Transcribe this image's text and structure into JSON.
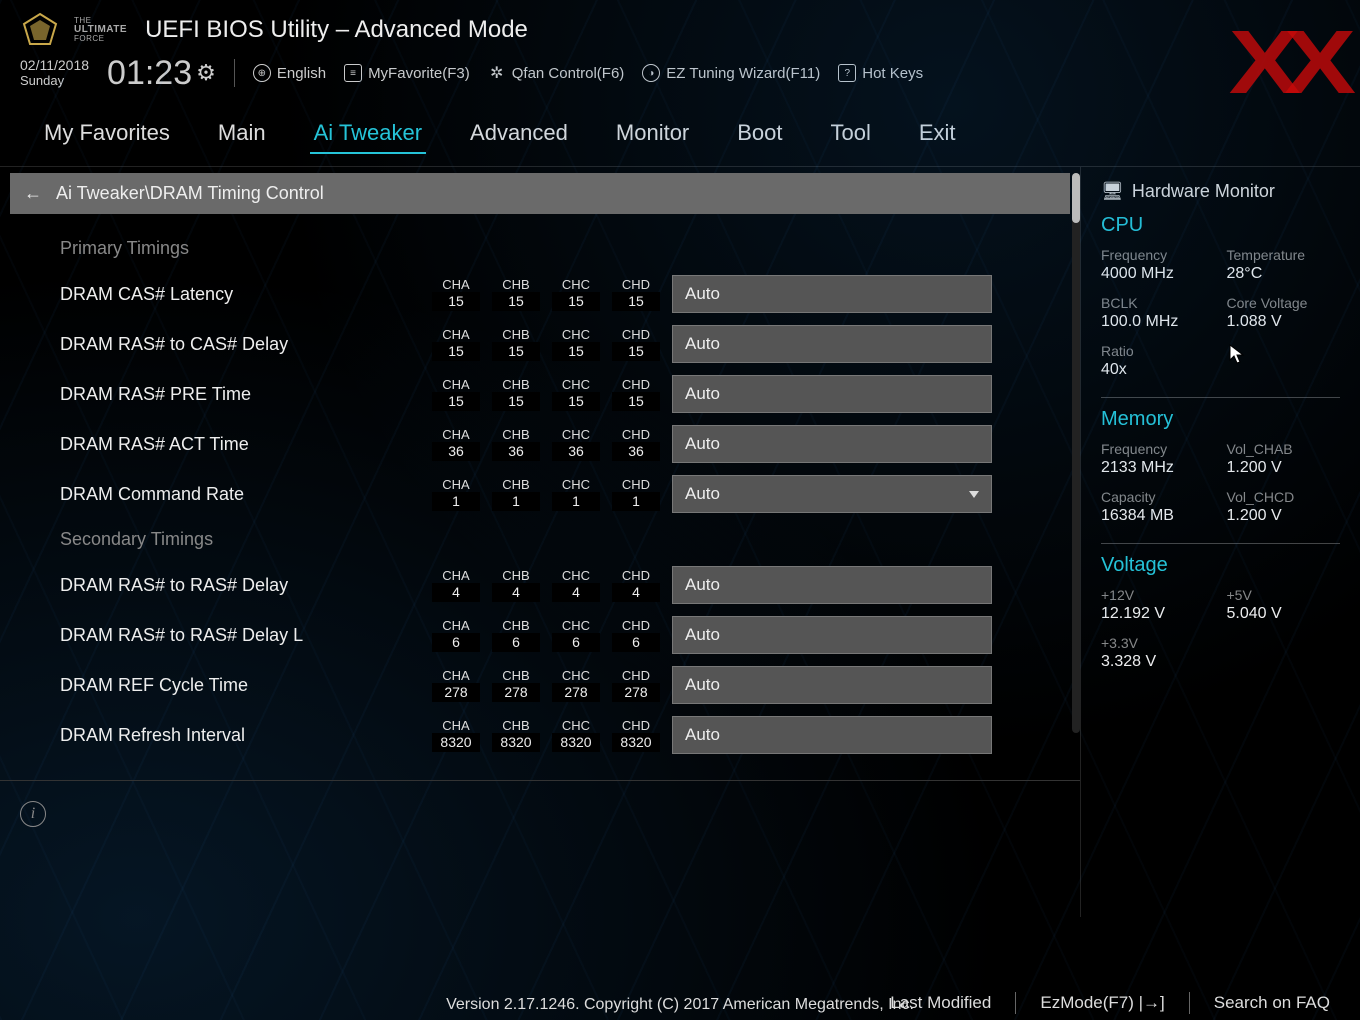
{
  "brand": {
    "line1": "THE",
    "line2": "ULTIMATE",
    "line3": "FORCE"
  },
  "title": "UEFI BIOS Utility – Advanced Mode",
  "date": "02/11/2018",
  "day": "Sunday",
  "time": "01:23",
  "toolbar": {
    "language": "English",
    "favorite": "MyFavorite(F3)",
    "qfan": "Qfan Control(F6)",
    "ez_wizard": "EZ Tuning Wizard(F11)",
    "hotkeys": "Hot Keys"
  },
  "tabs": [
    "My Favorites",
    "Main",
    "Ai Tweaker",
    "Advanced",
    "Monitor",
    "Boot",
    "Tool",
    "Exit"
  ],
  "active_tab": "Ai Tweaker",
  "breadcrumb": "Ai Tweaker\\DRAM Timing Control",
  "sections": [
    {
      "title": "Primary Timings",
      "rows": [
        {
          "label": "DRAM CAS# Latency",
          "ch": [
            "15",
            "15",
            "15",
            "15"
          ],
          "value": "Auto",
          "dropdown": false
        },
        {
          "label": "DRAM RAS# to CAS# Delay",
          "ch": [
            "15",
            "15",
            "15",
            "15"
          ],
          "value": "Auto",
          "dropdown": false
        },
        {
          "label": "DRAM RAS# PRE Time",
          "ch": [
            "15",
            "15",
            "15",
            "15"
          ],
          "value": "Auto",
          "dropdown": false
        },
        {
          "label": "DRAM RAS# ACT Time",
          "ch": [
            "36",
            "36",
            "36",
            "36"
          ],
          "value": "Auto",
          "dropdown": false
        },
        {
          "label": "DRAM Command Rate",
          "ch": [
            "1",
            "1",
            "1",
            "1"
          ],
          "value": "Auto",
          "dropdown": true
        }
      ]
    },
    {
      "title": "Secondary Timings",
      "rows": [
        {
          "label": "DRAM RAS# to RAS# Delay",
          "ch": [
            "4",
            "4",
            "4",
            "4"
          ],
          "value": "Auto",
          "dropdown": false
        },
        {
          "label": "DRAM RAS# to RAS# Delay L",
          "ch": [
            "6",
            "6",
            "6",
            "6"
          ],
          "value": "Auto",
          "dropdown": false
        },
        {
          "label": "DRAM REF Cycle Time",
          "ch": [
            "278",
            "278",
            "278",
            "278"
          ],
          "value": "Auto",
          "dropdown": false
        },
        {
          "label": "DRAM Refresh Interval",
          "ch": [
            "8320",
            "8320",
            "8320",
            "8320"
          ],
          "value": "Auto",
          "dropdown": false
        }
      ]
    }
  ],
  "channels": [
    "CHA",
    "CHB",
    "CHC",
    "CHD"
  ],
  "sidebar": {
    "title": "Hardware Monitor",
    "cpu": {
      "head": "CPU",
      "items": [
        {
          "k": "Frequency",
          "v": "4000 MHz"
        },
        {
          "k": "Temperature",
          "v": "28°C"
        },
        {
          "k": "BCLK",
          "v": "100.0 MHz"
        },
        {
          "k": "Core Voltage",
          "v": "1.088 V"
        },
        {
          "k": "Ratio",
          "v": "40x"
        }
      ]
    },
    "memory": {
      "head": "Memory",
      "items": [
        {
          "k": "Frequency",
          "v": "2133 MHz"
        },
        {
          "k": "Vol_CHAB",
          "v": "1.200 V"
        },
        {
          "k": "Capacity",
          "v": "16384 MB"
        },
        {
          "k": "Vol_CHCD",
          "v": "1.200 V"
        }
      ]
    },
    "voltage": {
      "head": "Voltage",
      "items": [
        {
          "k": "+12V",
          "v": "12.192 V"
        },
        {
          "k": "+5V",
          "v": "5.040 V"
        },
        {
          "k": "+3.3V",
          "v": "3.328 V"
        }
      ]
    }
  },
  "footer": {
    "last_modified": "Last Modified",
    "ezmode": "EzMode(F7)",
    "search": "Search on FAQ"
  },
  "copyright": "Version 2.17.1246. Copyright (C) 2017 American Megatrends, Inc.",
  "watermark": "XX"
}
